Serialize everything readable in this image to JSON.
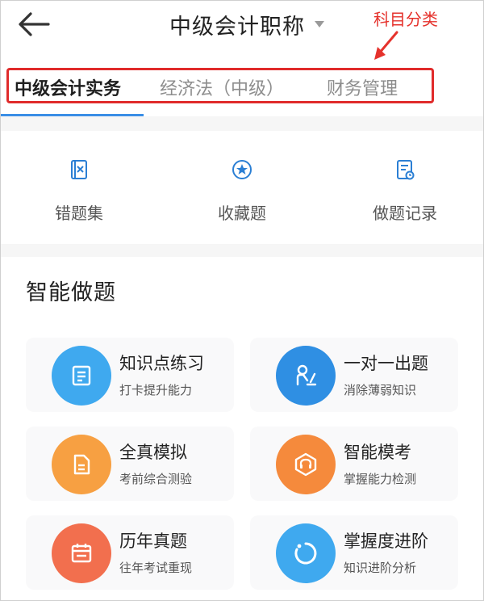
{
  "header": {
    "title": "中级会计职称",
    "annotation": "科目分类"
  },
  "tabs": [
    {
      "label": "中级会计实务",
      "active": true
    },
    {
      "label": "经济法（中级）",
      "active": false
    },
    {
      "label": "财务管理",
      "active": false
    }
  ],
  "quick_actions": [
    {
      "label": "错题集",
      "icon": "wrong-book-icon"
    },
    {
      "label": "收藏题",
      "icon": "star-icon"
    },
    {
      "label": "做题记录",
      "icon": "record-icon"
    }
  ],
  "section": {
    "title": "智能做题",
    "cards": [
      {
        "title": "知识点练习",
        "subtitle": "打卡提升能力",
        "icon": "document-icon",
        "color": "#3fa9ef"
      },
      {
        "title": "一对一出题",
        "subtitle": "消除薄弱知识",
        "icon": "person-icon",
        "color": "#2f8fe3"
      },
      {
        "title": "全真模拟",
        "subtitle": "考前综合测验",
        "icon": "paper-icon",
        "color": "#f7a042"
      },
      {
        "title": "智能模考",
        "subtitle": "掌握能力检测",
        "icon": "headset-icon",
        "color": "#f58a3c"
      },
      {
        "title": "历年真题",
        "subtitle": "往年考试重现",
        "icon": "calendar-icon",
        "color": "#f26f4e"
      },
      {
        "title": "掌握度进阶",
        "subtitle": "知识进阶分析",
        "icon": "progress-ring-icon",
        "color": "#3fa9ef"
      }
    ]
  },
  "colors": {
    "accent": "#3a8ee6",
    "annotation": "#e5322c"
  }
}
